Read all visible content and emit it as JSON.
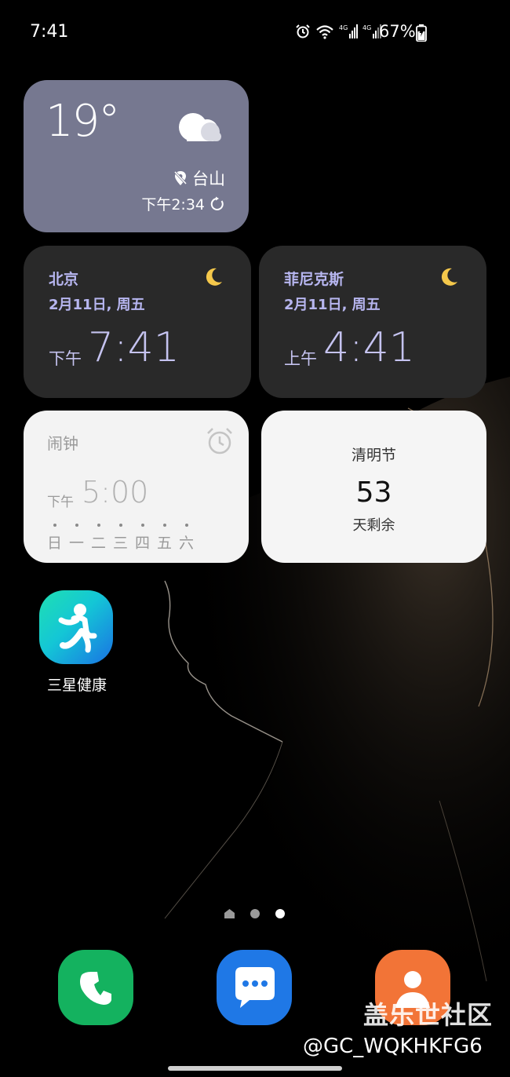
{
  "status_bar": {
    "time": "7:41",
    "battery_percent": "67%",
    "icons": [
      "alarm-icon",
      "wifi-icon",
      "signal-4g-icon",
      "signal-4g-icon",
      "battery-charging-icon"
    ]
  },
  "weather": {
    "temperature": "19°",
    "location": "台山",
    "updated": "下午2:34",
    "condition_icon": "partly-cloudy-night-icon"
  },
  "world_clocks": [
    {
      "city": "北京",
      "date": "2月11日, 周五",
      "ampm": "下午",
      "time": "7:41"
    },
    {
      "city": "菲尼克斯",
      "date": "2月11日, 周五",
      "ampm": "上午",
      "time": "4:41"
    }
  ],
  "alarm": {
    "title": "闹钟",
    "ampm": "下午",
    "time": "5:00",
    "days": [
      "日",
      "一",
      "二",
      "三",
      "四",
      "五",
      "六"
    ]
  },
  "countdown": {
    "event": "清明节",
    "days": "53",
    "label": "天剩余"
  },
  "apps": [
    {
      "label": "三星健康",
      "icon": "samsung-health-icon"
    }
  ],
  "dock": [
    {
      "icon": "phone-icon"
    },
    {
      "icon": "messages-icon"
    },
    {
      "icon": "contacts-icon"
    }
  ],
  "watermark": {
    "brand": "盖乐世社区",
    "user": "@GC_WQKHKFG6"
  },
  "colors": {
    "weather_bg": "#767890",
    "clock_bg": "#292929",
    "clock_text": "#b7b6f0",
    "widget_light_bg": "#f3f3f3",
    "moon": "#f5c84b"
  }
}
